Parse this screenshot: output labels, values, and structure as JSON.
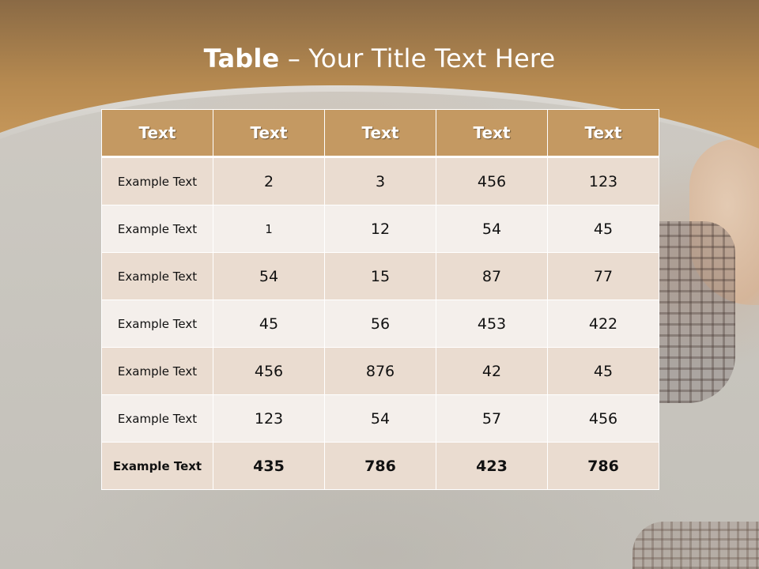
{
  "slide": {
    "title_bold": "Table",
    "title_rest": " – Your Title Text Here"
  },
  "colors": {
    "banner_brown": "#b98a50",
    "header_fill": "#c49962",
    "row_odd": "#eadcd0",
    "row_even": "#f4efeb"
  },
  "table": {
    "headers": [
      "Text",
      "Text",
      "Text",
      "Text",
      "Text"
    ],
    "rows": [
      [
        "Example Text",
        "2",
        "3",
        "456",
        "123"
      ],
      [
        "Example Text",
        "1",
        "12",
        "54",
        "45"
      ],
      [
        "Example Text",
        "54",
        "15",
        "87",
        "77"
      ],
      [
        "Example Text",
        "45",
        "56",
        "453",
        "422"
      ],
      [
        "Example Text",
        "456",
        "876",
        "42",
        "45"
      ],
      [
        "Example Text",
        "123",
        "54",
        "57",
        "456"
      ],
      [
        "Example Text",
        "435",
        "786",
        "423",
        "786"
      ]
    ]
  }
}
